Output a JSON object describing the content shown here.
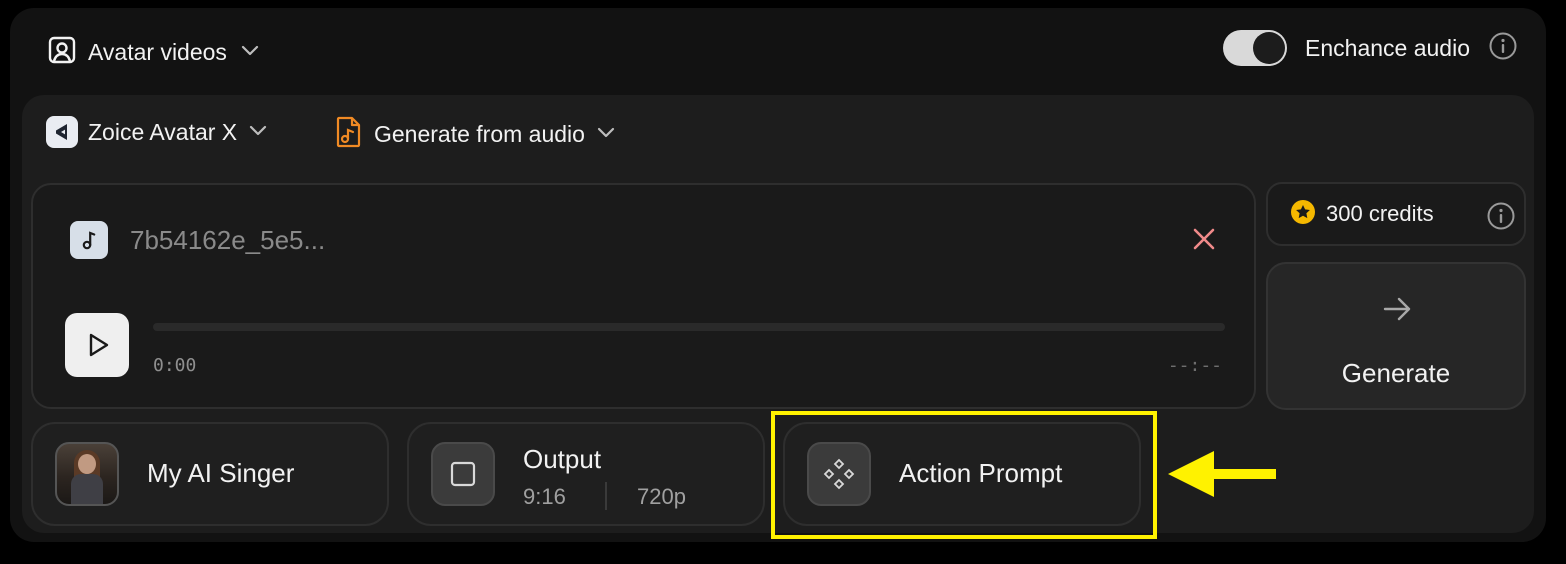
{
  "header": {
    "mode_label": "Avatar videos",
    "enhance_label": "Enchance audio",
    "enhance_enabled": true
  },
  "selectors": {
    "model_label": "Zoice Avatar X",
    "source_label": "Generate from audio"
  },
  "audio": {
    "filename": "7b54162e_5e5...",
    "current_time": "0:00",
    "duration": "--:--"
  },
  "credits": {
    "label": "300 credits"
  },
  "generate": {
    "label": "Generate"
  },
  "cards": {
    "singer": {
      "title": "My AI Singer"
    },
    "output": {
      "title": "Output",
      "ratio": "9:16",
      "resolution": "720p"
    },
    "action": {
      "title": "Action Prompt"
    }
  },
  "colors": {
    "highlight": "#fff200",
    "credit_star": "#f5b800",
    "source_icon": "#f08a24",
    "close": "#f08a8a"
  }
}
